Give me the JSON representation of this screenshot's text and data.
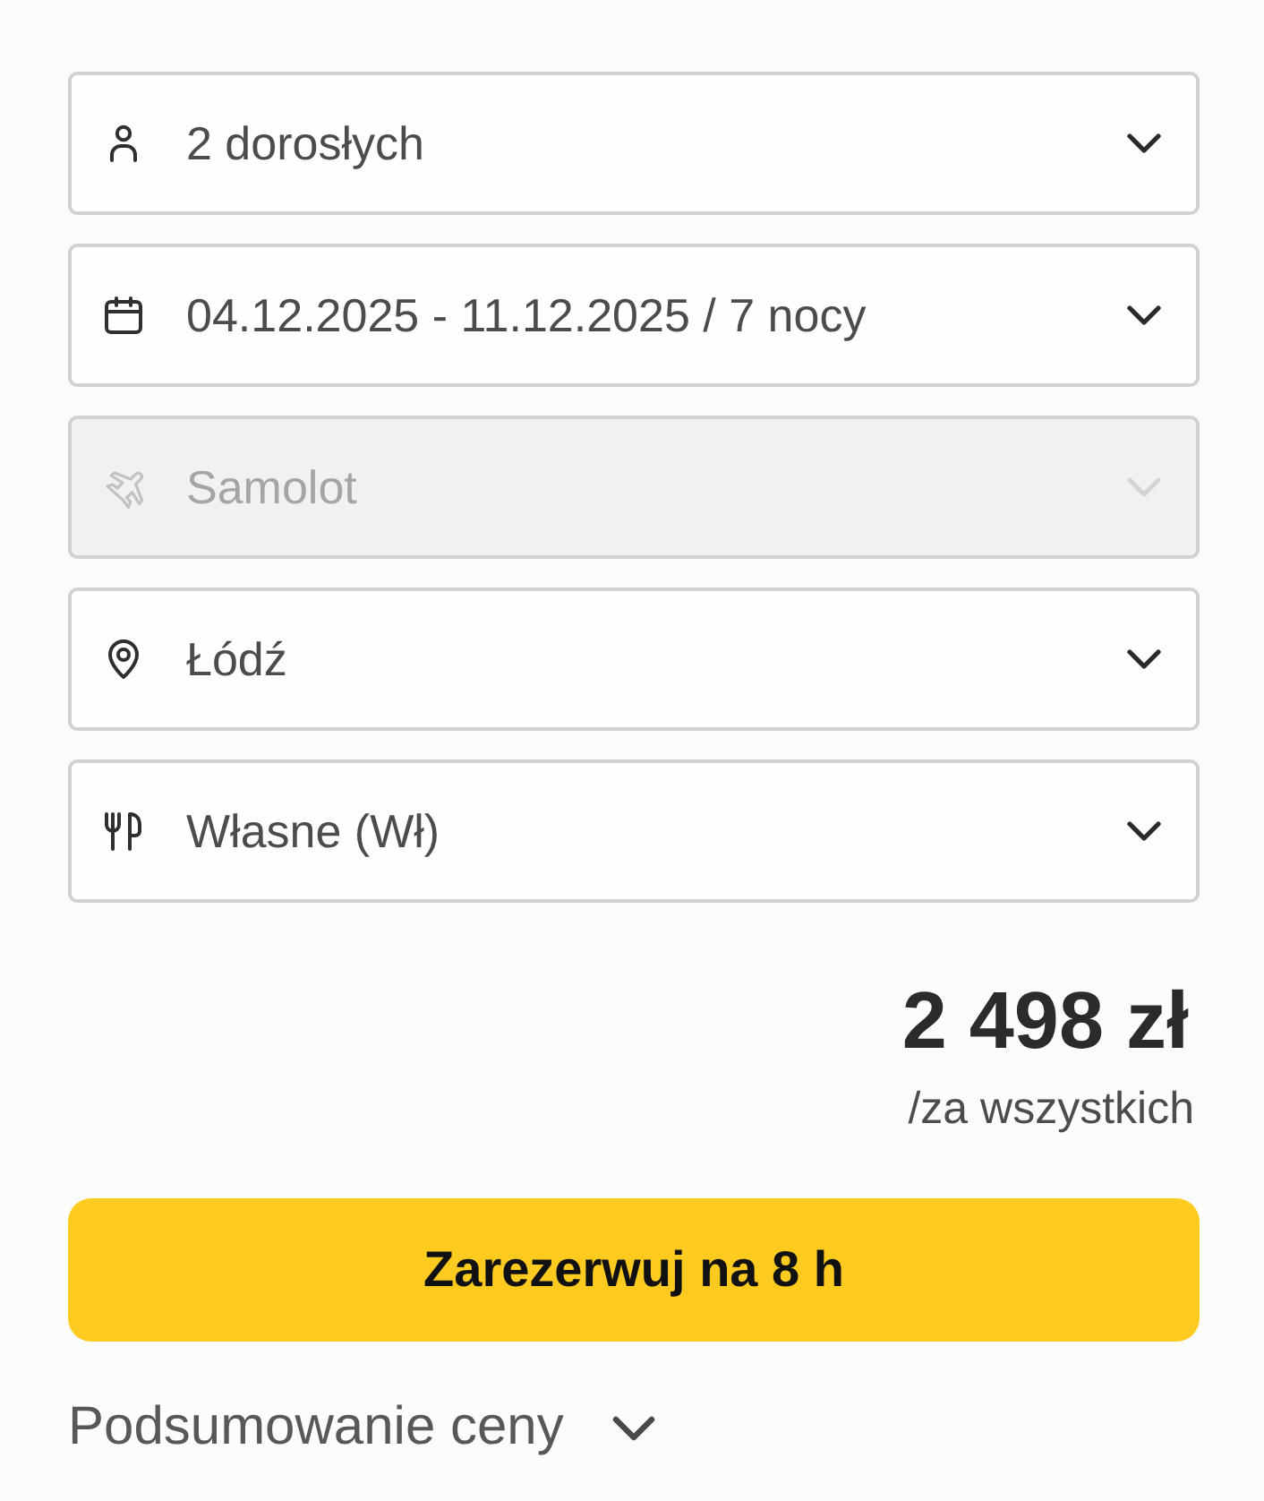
{
  "fields": [
    {
      "kind": "travelers",
      "value": "2 dorosłych",
      "disabled": false
    },
    {
      "kind": "dates",
      "value": "04.12.2025 - 11.12.2025 / 7 nocy",
      "disabled": false
    },
    {
      "kind": "transport",
      "value": "Samolot",
      "disabled": true
    },
    {
      "kind": "departure",
      "value": "Łódź",
      "disabled": false
    },
    {
      "kind": "meals",
      "value": "Własne (Wł)",
      "disabled": false
    }
  ],
  "price": {
    "amount": "2 498 zł",
    "note": "/za wszystkich"
  },
  "book_button": {
    "label": "Zarezerwuj na 8 h"
  },
  "summary": {
    "label": "Podsumowanie ceny",
    "expanded": false
  }
}
